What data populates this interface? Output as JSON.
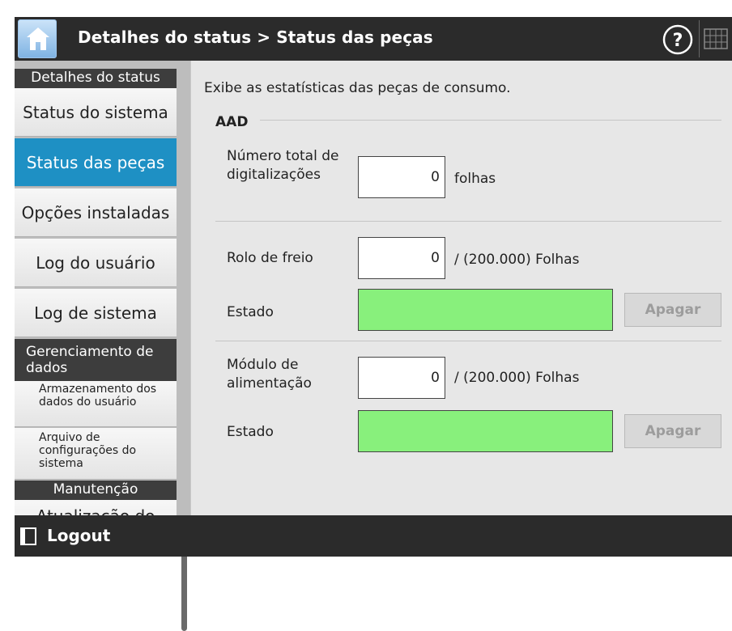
{
  "header": {
    "title": "Detalhes do status > Status das peças",
    "home_icon": "home-icon",
    "help_icon": "help-icon",
    "keyboard_icon": "keyboard-icon"
  },
  "sidebar": {
    "section_status": "Detalhes do status",
    "items": [
      {
        "label": "Status do sistema"
      },
      {
        "label": "Status das peças",
        "active": true
      },
      {
        "label": "Opções instaladas"
      },
      {
        "label": "Log do usuário"
      },
      {
        "label": "Log de sistema"
      }
    ],
    "section_data": "Gerenciamento de dados",
    "data_items": [
      {
        "label": "Armazenamento dos dados do usuário"
      },
      {
        "label": "Arquivo de configurações do sistema"
      }
    ],
    "section_maint": "Manutenção",
    "maint_items": [
      {
        "label": "Atualização do"
      }
    ]
  },
  "main": {
    "description": "Exibe as estatísticas das peças de consumo.",
    "group_title": "AAD",
    "total_scans": {
      "label": "Número total de digitalizações",
      "value": "0",
      "unit": "folhas"
    },
    "brake_roller": {
      "label": "Rolo de freio",
      "value": "0",
      "unit": "/ (200.000) Folhas",
      "status_label": "Estado",
      "clear_label": "Apagar"
    },
    "feed_module": {
      "label": "Módulo de alimentação",
      "value": "0",
      "unit": "/ (200.000) Folhas",
      "status_label": "Estado",
      "clear_label": "Apagar"
    }
  },
  "footer": {
    "logout_label": "Logout",
    "logout_icon": "logout-icon"
  },
  "colors": {
    "accent": "#1e90c4",
    "status_ok": "#88f07c",
    "header_bg": "#2b2b2b"
  }
}
